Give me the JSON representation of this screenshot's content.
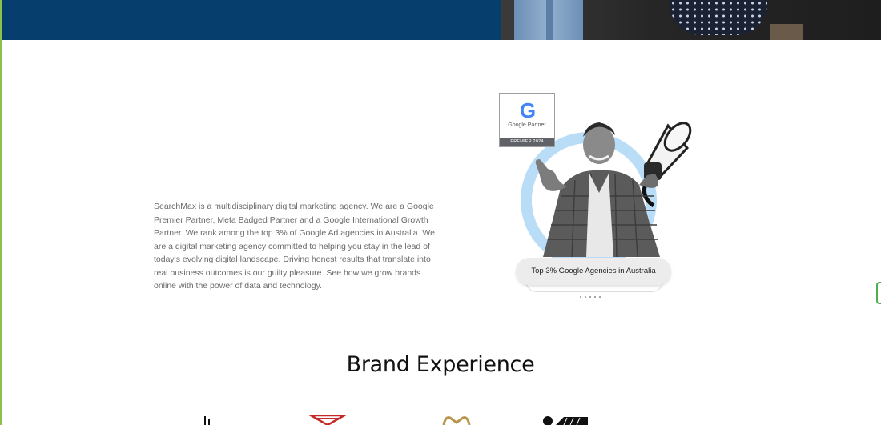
{
  "about": {
    "paragraph": "SearchMax is a multidisciplinary digital marketing agency. We are a Google Premier Partner, Meta Badged Partner and a Google International Growth Partner. We rank among the top 3% of Google Ad agencies in Australia. We are a digital marketing agency committed to helping you stay in the lead of today's evolving digital landscape. Driving honest results that translate into real business outcomes is our guilty pleasure. See how we grow brands online with the power of data and technology."
  },
  "badge": {
    "logo_letter": "G",
    "name": "Google Partner",
    "tier": "PREMIER 2024"
  },
  "pill": {
    "label": "Top 3% Google Agencies in Australia"
  },
  "brand_section": {
    "heading": "Brand Experience"
  },
  "colors": {
    "hero_bg": "#063f6e",
    "ring": "#b9dcf7",
    "accent_green": "#8bc34a"
  }
}
